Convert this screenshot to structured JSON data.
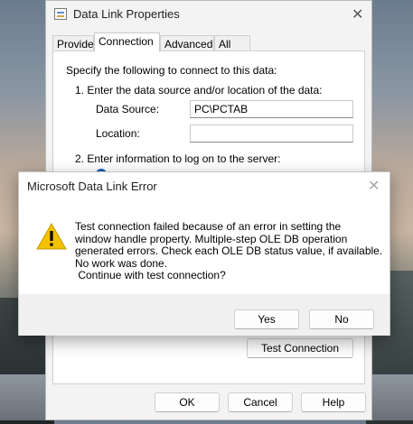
{
  "props_window": {
    "title": "Data Link Properties",
    "close_glyph": "✕",
    "tabs": [
      "Provider",
      "Connection",
      "Advanced",
      "All"
    ],
    "active_tab": "Connection",
    "intro": "Specify the following to connect to this data:",
    "step1": "1. Enter the data source and/or location of the data:",
    "data_source_label": "Data Source:",
    "data_source_value": "PC\\PCTAB",
    "location_label": "Location:",
    "location_value": "",
    "step2": "2. Enter information to log on to the server:",
    "test_connection_label": "Test Connection",
    "ok_label": "OK",
    "cancel_label": "Cancel",
    "help_label": "Help"
  },
  "error_dialog": {
    "title": "Microsoft Data Link Error",
    "close_glyph": "✕",
    "message": "Test connection failed because of an error in setting the\nwindow handle property. Multiple-step OLE DB operation\ngenerated errors. Check each OLE DB status value, if available.\nNo work was done.\n Continue with test connection?",
    "yes_label": "Yes",
    "no_label": "No",
    "icon": "warning-icon"
  },
  "colors": {
    "accent": "#0f5fb8",
    "warning_fill": "#f2c200"
  }
}
